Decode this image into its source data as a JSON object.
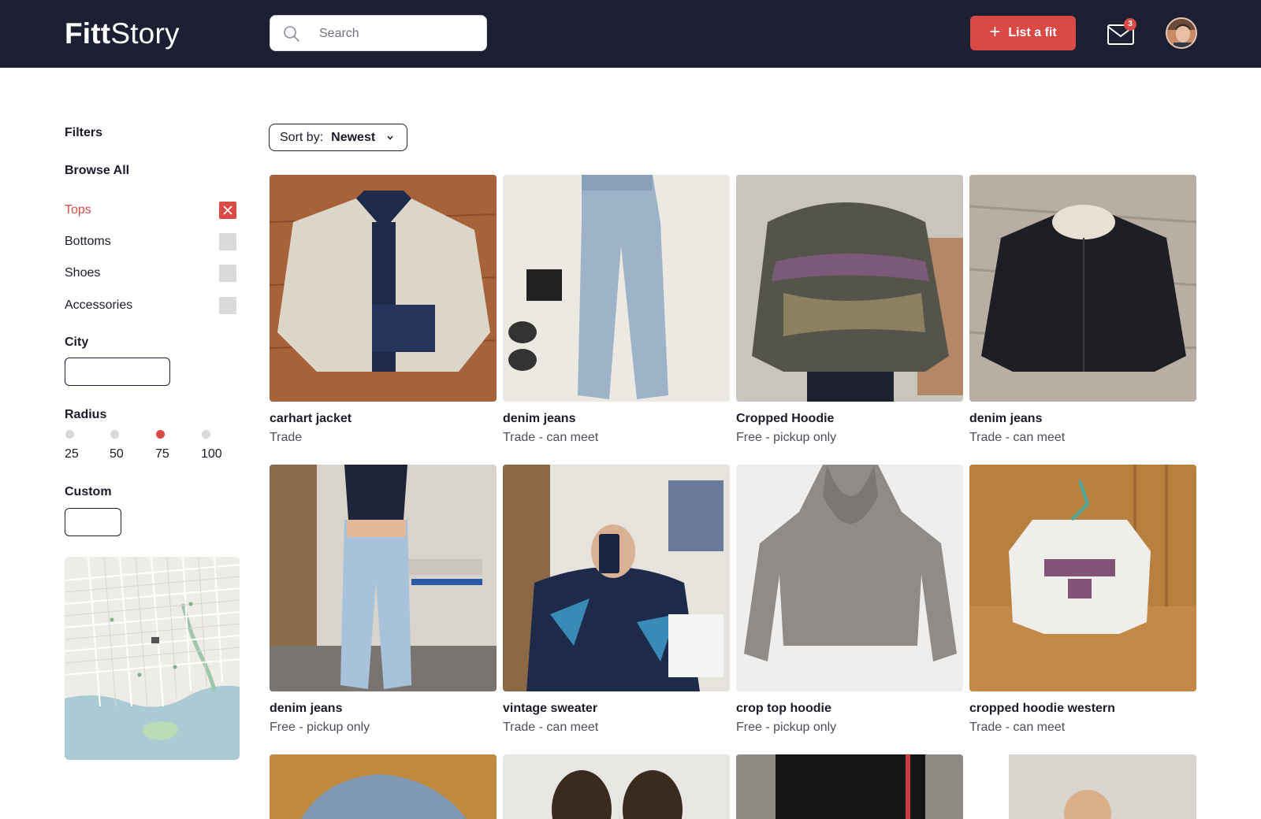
{
  "header": {
    "logo_bold": "Fitt",
    "logo_light": "Story",
    "search_placeholder": "Search",
    "list_button": "List a fit",
    "mail_badge": "3"
  },
  "sidebar": {
    "filters_title": "Filters",
    "browse_all": "Browse All",
    "categories": [
      {
        "label": "Tops",
        "checked": true
      },
      {
        "label": "Bottoms",
        "checked": false
      },
      {
        "label": "Shoes",
        "checked": false
      },
      {
        "label": "Accessories",
        "checked": false
      }
    ],
    "city_title": "City",
    "radius_title": "Radius",
    "radius_options": [
      "25",
      "50",
      "75",
      "100"
    ],
    "radius_selected": "75",
    "custom_title": "Custom"
  },
  "sort": {
    "label": "Sort by:",
    "value": "Newest"
  },
  "listings": [
    {
      "title": "carhart jacket",
      "sub": "Trade"
    },
    {
      "title": "denim jeans",
      "sub": "Trade - can meet"
    },
    {
      "title": "Cropped Hoodie",
      "sub": "Free - pickup only"
    },
    {
      "title": "denim jeans",
      "sub": "Trade - can meet"
    },
    {
      "title": "denim jeans",
      "sub": "Free - pickup only"
    },
    {
      "title": "vintage sweater",
      "sub": "Trade - can meet"
    },
    {
      "title": "crop top hoodie",
      "sub": "Free - pickup only"
    },
    {
      "title": "cropped hoodie western",
      "sub": "Trade - can meet"
    }
  ],
  "colors": {
    "header_bg": "#1c1e31",
    "accent": "#d94a47"
  }
}
